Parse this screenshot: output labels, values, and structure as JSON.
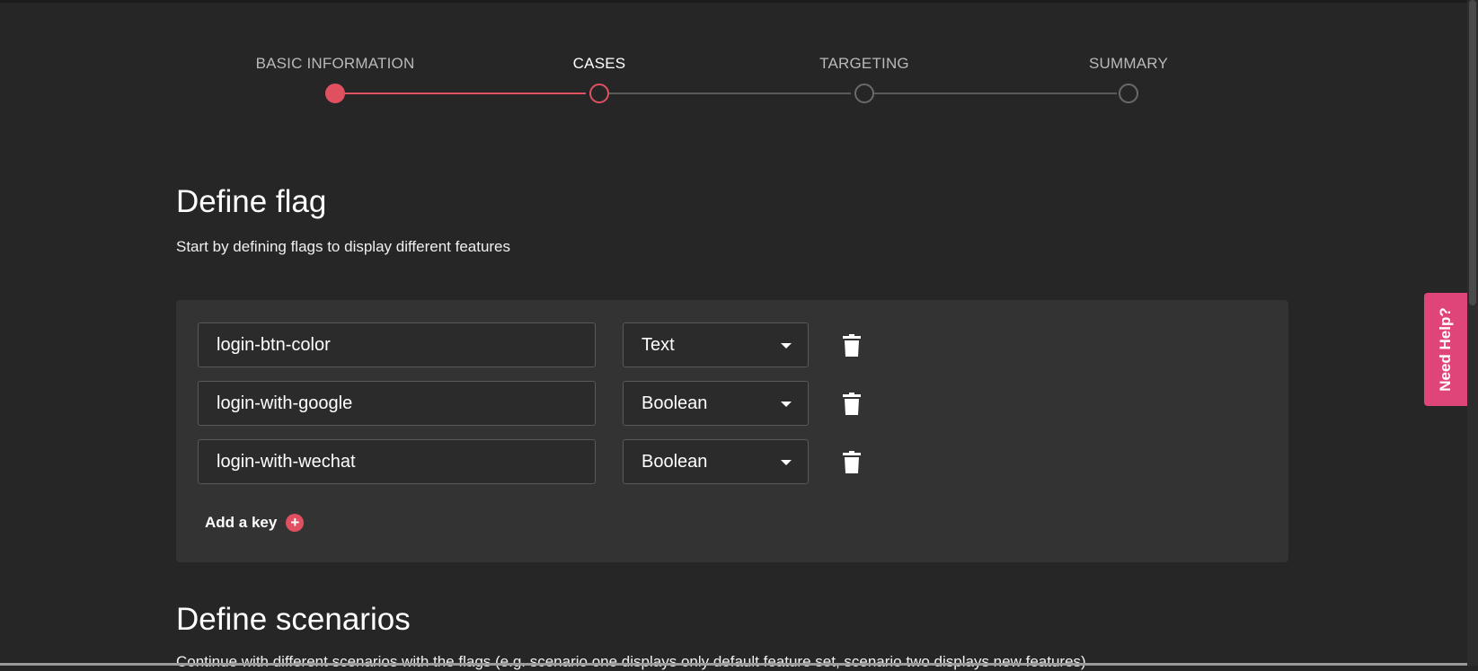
{
  "stepper": {
    "steps": [
      {
        "label": "BASIC INFORMATION",
        "state": "done"
      },
      {
        "label": "CASES",
        "state": "current"
      },
      {
        "label": "TARGETING",
        "state": "upcoming"
      },
      {
        "label": "SUMMARY",
        "state": "upcoming"
      }
    ],
    "accent_color": "#e05060"
  },
  "define_flag": {
    "title": "Define flag",
    "subtitle": "Start by defining flags to display different features",
    "keys": [
      {
        "name": "login-btn-color",
        "type": "Text"
      },
      {
        "name": "login-with-google",
        "type": "Boolean"
      },
      {
        "name": "login-with-wechat",
        "type": "Boolean"
      }
    ],
    "add_key_label": "Add a key",
    "add_key_icon": "+"
  },
  "define_scenarios": {
    "title": "Define scenarios",
    "subtitle": "Continue with different scenarios with the flags (e.g. scenario one displays only default feature set, scenario two displays new features)"
  },
  "help": {
    "label": "Need Help?",
    "color": "#e0457a"
  }
}
